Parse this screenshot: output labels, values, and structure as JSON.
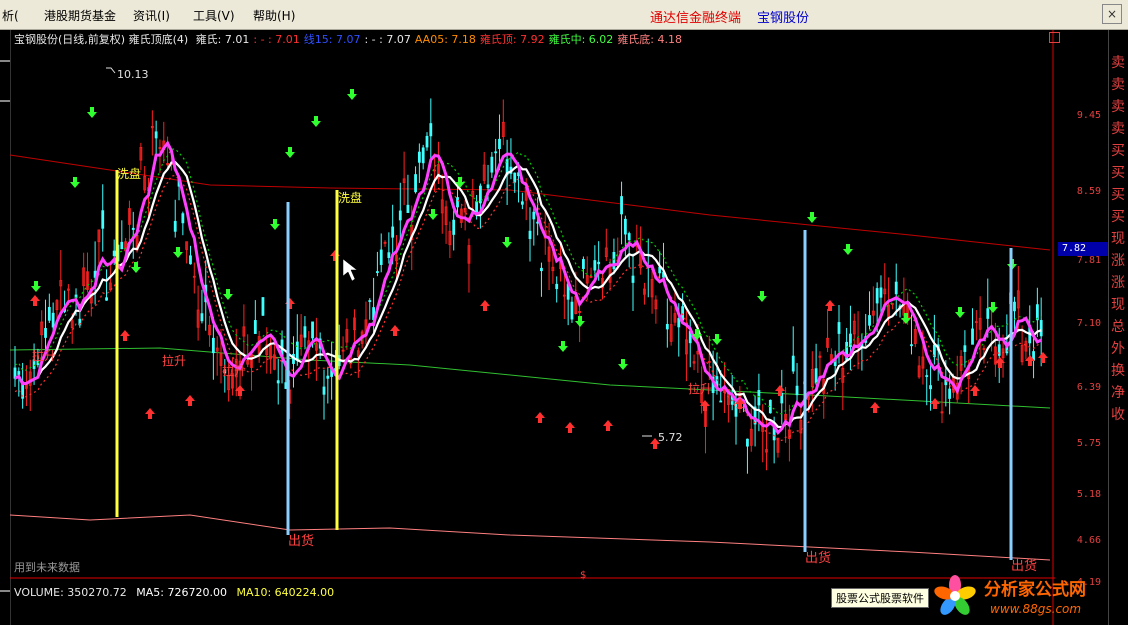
{
  "menu": {
    "items": [
      "析(",
      "港股期货基金",
      "资讯(I)",
      "工具(V)",
      "帮助(H)"
    ],
    "brand": "通达信金融终端",
    "stock_name": "宝钢股份",
    "close": "×"
  },
  "info": {
    "title": "宝钢股份(日线,前复权)",
    "indicator": "雍氏顶底(4)",
    "fields": [
      {
        "label": "雍氏: 7.01",
        "color": "#e8e8e8"
      },
      {
        "label": ": - : 7.01",
        "color": "#ff3030"
      },
      {
        "label": "线15: 7.07",
        "color": "#3050ff"
      },
      {
        "label": ": - : 7.07",
        "color": "#e8e8e8"
      },
      {
        "label": "AA05: 7.18",
        "color": "#ff8c00"
      },
      {
        "label": "雍氏顶: 7.92",
        "color": "#ff3030"
      },
      {
        "label": "雍氏中: 6.02",
        "color": "#40ff40"
      },
      {
        "label": "雍氏底: 4.18",
        "color": "#ff8080"
      }
    ]
  },
  "volume": {
    "text": "VOLUME: 350270.72",
    "ma5": "MA5: 726720.00",
    "ma10": "MA10: 640224.00"
  },
  "future_note": "用到未来数据",
  "tooltip": "股票公式股票软件",
  "current_price": "7.82",
  "price_axis": [
    "9.45",
    "8.59",
    "7.81",
    "7.10",
    "6.39",
    "5.75",
    "5.18",
    "4.66",
    "4.19"
  ],
  "right_panel": [
    "卖",
    "卖",
    "卖",
    "卖",
    "买",
    "买",
    "买",
    "买",
    "现",
    "涨",
    "涨",
    "现",
    "总",
    "外",
    "换",
    "净",
    "收"
  ],
  "annotations": {
    "high": "10.13",
    "low": "5.72",
    "labels": [
      "拉升",
      "拉升",
      "拉升",
      "拉升",
      "洗盘",
      "洗盘",
      "出货",
      "出货",
      "出货"
    ]
  },
  "logo": {
    "name": "分析家公式网",
    "url": "www.88gs.com"
  },
  "colors": {
    "up": "#ff2020",
    "down": "#40ffff",
    "ma_main": "#ff40ff",
    "ma_white": "#ffffff",
    "top_line": "#c00000",
    "mid_line": "#30c030",
    "bottom_line": "#ff8080",
    "signal_up": "#ff3030",
    "signal_down": "#30ff30",
    "yellow_bar": "#ffff40",
    "blue_bar": "#8ad0ff"
  },
  "chart_data": {
    "type": "candlestick",
    "title": "宝钢股份(日线,前复权)",
    "ylim": [
      4.0,
      10.3
    ],
    "price_ticks": [
      9.45,
      8.59,
      7.81,
      7.1,
      6.39,
      5.75,
      5.18,
      4.66,
      4.19
    ],
    "extremes": {
      "high": 10.13,
      "low": 5.72
    },
    "close_path": [
      6.5,
      6.6,
      6.9,
      7.2,
      7.5,
      7.3,
      7.7,
      7.9,
      7.6,
      8.0,
      8.3,
      8.8,
      9.3,
      9.0,
      8.4,
      7.8,
      7.2,
      7.0,
      6.8,
      6.6,
      6.8,
      7.0,
      6.9,
      6.6,
      6.5,
      6.7,
      6.8,
      6.6,
      6.7,
      6.9,
      7.1,
      7.4,
      7.8,
      8.1,
      8.5,
      8.8,
      9.0,
      8.7,
      8.4,
      8.2,
      8.6,
      8.9,
      9.2,
      9.0,
      8.7,
      8.3,
      8.0,
      7.6,
      7.3,
      7.5,
      7.9,
      7.9,
      7.8,
      8.1,
      7.8,
      7.5,
      7.4,
      7.1,
      6.9,
      6.6,
      6.4,
      6.3,
      6.2,
      6.1,
      6.0,
      5.9,
      6.0,
      6.2,
      6.3,
      6.5,
      6.6,
      6.7,
      6.8,
      6.9,
      7.1,
      7.4,
      7.6,
      7.3,
      7.1,
      6.8,
      6.6,
      6.4,
      6.6,
      6.8,
      6.9,
      6.9,
      7.0,
      7.2,
      7.0,
      6.9
    ],
    "buy_signals": 28,
    "sell_signals": 24
  }
}
